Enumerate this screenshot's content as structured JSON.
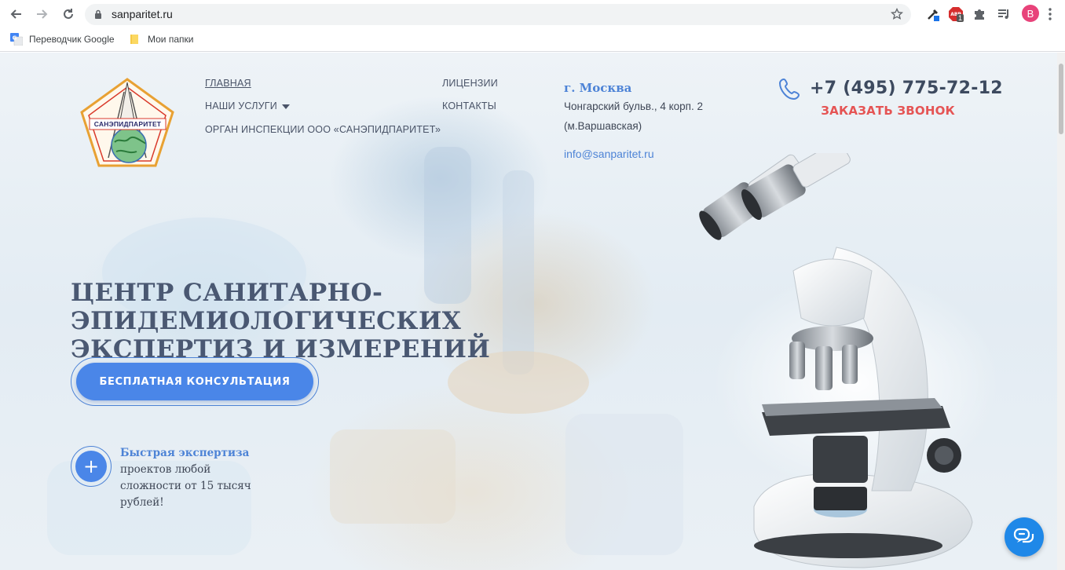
{
  "browser": {
    "url": "sanparitet.ru",
    "profile_initial": "B",
    "bookmarks": [
      {
        "label": "Переводчик Google",
        "icon": "google-translate-icon"
      },
      {
        "label": "Мои папки",
        "icon": "folder-icon"
      }
    ],
    "extension_badge": "1"
  },
  "site": {
    "logo_text": "САНЭПИДПАРИТЕТ",
    "nav": {
      "home": "ГЛАВНАЯ",
      "services": "НАШИ УСЛУГИ",
      "inspection": "ОРГАН ИНСПЕКЦИИ ООО «САНЭПИДПАРИТЕТ»",
      "licenses": "ЛИЦЕНЗИИ",
      "contacts": "КОНТАКТЫ"
    },
    "contact": {
      "city": "г. Москва",
      "address_line1": "Чонгарский бульв., 4 корп. 2",
      "address_line2": "(м.Варшавская)",
      "email": "info@sanparitet.ru",
      "phone": "+7 (495) 775-72-12",
      "callback": "ЗАКАЗАТЬ ЗВОНОК"
    },
    "hero": {
      "title_line1": "ЦЕНТР САНИТАРНО-ЭПИДЕМИОЛОГИЧЕСКИХ",
      "title_line2": "ЭКСПЕРТИЗ И ИЗМЕРЕНИЙ",
      "cta": "БЕСПЛАТНАЯ КОНСУЛЬТАЦИЯ"
    },
    "feature": {
      "icon_symbol": "+",
      "title": "Быстрая экспертиза",
      "line1": "проектов любой",
      "line2": "сложности от 15 тысяч",
      "line3": "рублей!"
    }
  },
  "colors": {
    "accent": "#4a86e8",
    "link": "#4d83d6",
    "callback": "#e55454",
    "title": "#4a5872",
    "chat": "#1f88e8"
  }
}
